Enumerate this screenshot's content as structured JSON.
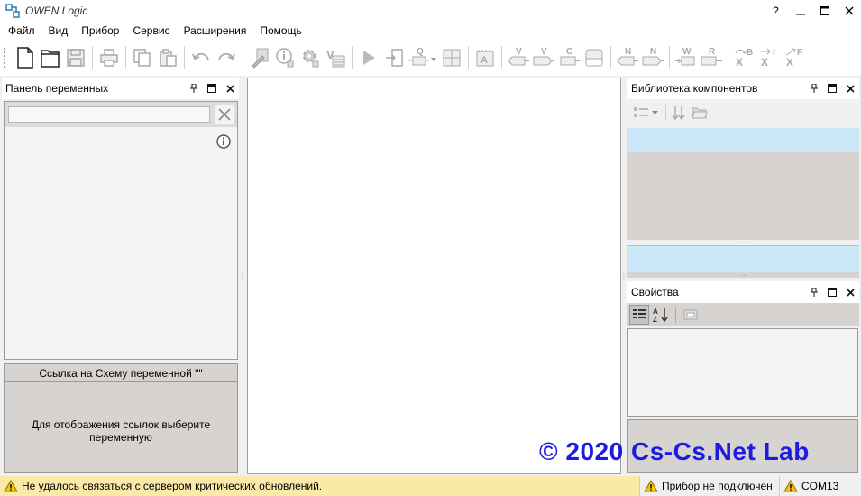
{
  "app": {
    "title": "OWEN Logic"
  },
  "window_controls": {
    "help": "?",
    "minimize": "—",
    "maximize": "☐",
    "close": "✕"
  },
  "menu": [
    "Файл",
    "Вид",
    "Прибор",
    "Сервис",
    "Расширения",
    "Помощь"
  ],
  "variables_panel": {
    "title": "Панель переменных",
    "search_placeholder": "",
    "link_header": "Ссылка на Схему переменной \"\"",
    "link_hint": "Для отображения ссылок выберите переменную"
  },
  "library_panel": {
    "title": "Библиотека компонентов"
  },
  "properties_panel": {
    "title": "Свойства"
  },
  "toolbar_letters": {
    "v1": "V",
    "v2": "V",
    "c": "C",
    "n1": "N",
    "n2": "N",
    "w": "W",
    "r": "R",
    "xb": "B",
    "xi": "I",
    "xf": "F",
    "x": "X",
    "q": "Q"
  },
  "status": {
    "message": "Не удалось связаться с сервером критических обновлений.",
    "device": "Прибор не подключен",
    "port": "COM13"
  },
  "watermark": "© 2020 Cs-Cs.Net Lab",
  "colors": {
    "status_warning_bg": "#fbe9a7",
    "selection": "#cce8f8",
    "watermark": "#1d1be0"
  }
}
